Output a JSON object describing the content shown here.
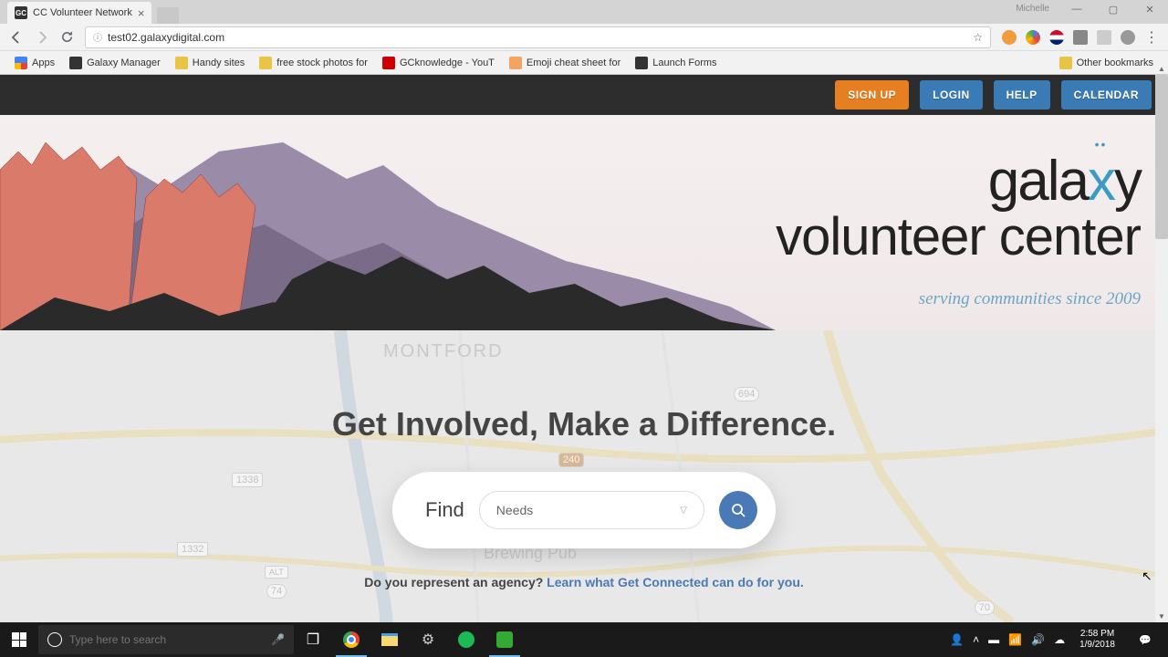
{
  "browser": {
    "profile_name": "Michelle",
    "tab_title": "CC Volunteer Network",
    "url": "test02.galaxydigital.com",
    "apps_label": "Apps",
    "bookmarks": [
      {
        "label": "Galaxy Manager",
        "color": "#333"
      },
      {
        "label": "Handy sites",
        "color": "#e8c547"
      },
      {
        "label": "free stock photos for",
        "color": "#e8c547"
      },
      {
        "label": "GCknowledge - YouT",
        "color": "#cc0000"
      },
      {
        "label": "Emoji cheat sheet for",
        "color": "#f4a460"
      },
      {
        "label": "Launch Forms",
        "color": "#333"
      }
    ],
    "other_bookmarks": "Other bookmarks"
  },
  "site_nav": {
    "signup": "SIGN UP",
    "login": "LOGIN",
    "help": "HELP",
    "calendar": "CALENDAR"
  },
  "hero": {
    "logo_part1": "gala",
    "logo_x": "x",
    "logo_part2": "y",
    "logo_line2": "volunteer center",
    "tagline": "serving communities since 2009"
  },
  "search": {
    "headline": "Get Involved, Make a Difference.",
    "find_label": "Find",
    "select_value": "Needs",
    "agency_prompt": "Do you represent an agency? ",
    "agency_link": "Learn what Get Connected can do for you."
  },
  "map_labels": {
    "montford": "MONTFORD",
    "r694": "694",
    "r1338": "1338",
    "r1332": "1332",
    "r74": "74",
    "alt": "ALT",
    "r240": "240",
    "r70": "70",
    "brewing": "Brewing Pub"
  },
  "taskbar": {
    "search_placeholder": "Type here to search",
    "time": "2:58 PM",
    "date": "1/9/2018"
  }
}
